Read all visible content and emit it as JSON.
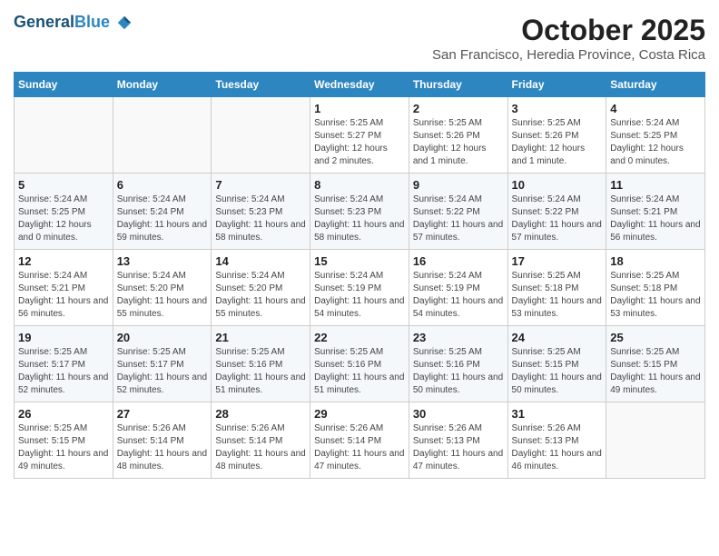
{
  "header": {
    "logo_line1": "General",
    "logo_line2": "Blue",
    "month_year": "October 2025",
    "location": "San Francisco, Heredia Province, Costa Rica"
  },
  "days_of_week": [
    "Sunday",
    "Monday",
    "Tuesday",
    "Wednesday",
    "Thursday",
    "Friday",
    "Saturday"
  ],
  "weeks": [
    [
      {
        "day": "",
        "sunrise": "",
        "sunset": "",
        "daylight": ""
      },
      {
        "day": "",
        "sunrise": "",
        "sunset": "",
        "daylight": ""
      },
      {
        "day": "",
        "sunrise": "",
        "sunset": "",
        "daylight": ""
      },
      {
        "day": "1",
        "sunrise": "Sunrise: 5:25 AM",
        "sunset": "Sunset: 5:27 PM",
        "daylight": "Daylight: 12 hours and 2 minutes."
      },
      {
        "day": "2",
        "sunrise": "Sunrise: 5:25 AM",
        "sunset": "Sunset: 5:26 PM",
        "daylight": "Daylight: 12 hours and 1 minute."
      },
      {
        "day": "3",
        "sunrise": "Sunrise: 5:25 AM",
        "sunset": "Sunset: 5:26 PM",
        "daylight": "Daylight: 12 hours and 1 minute."
      },
      {
        "day": "4",
        "sunrise": "Sunrise: 5:24 AM",
        "sunset": "Sunset: 5:25 PM",
        "daylight": "Daylight: 12 hours and 0 minutes."
      }
    ],
    [
      {
        "day": "5",
        "sunrise": "Sunrise: 5:24 AM",
        "sunset": "Sunset: 5:25 PM",
        "daylight": "Daylight: 12 hours and 0 minutes."
      },
      {
        "day": "6",
        "sunrise": "Sunrise: 5:24 AM",
        "sunset": "Sunset: 5:24 PM",
        "daylight": "Daylight: 11 hours and 59 minutes."
      },
      {
        "day": "7",
        "sunrise": "Sunrise: 5:24 AM",
        "sunset": "Sunset: 5:23 PM",
        "daylight": "Daylight: 11 hours and 58 minutes."
      },
      {
        "day": "8",
        "sunrise": "Sunrise: 5:24 AM",
        "sunset": "Sunset: 5:23 PM",
        "daylight": "Daylight: 11 hours and 58 minutes."
      },
      {
        "day": "9",
        "sunrise": "Sunrise: 5:24 AM",
        "sunset": "Sunset: 5:22 PM",
        "daylight": "Daylight: 11 hours and 57 minutes."
      },
      {
        "day": "10",
        "sunrise": "Sunrise: 5:24 AM",
        "sunset": "Sunset: 5:22 PM",
        "daylight": "Daylight: 11 hours and 57 minutes."
      },
      {
        "day": "11",
        "sunrise": "Sunrise: 5:24 AM",
        "sunset": "Sunset: 5:21 PM",
        "daylight": "Daylight: 11 hours and 56 minutes."
      }
    ],
    [
      {
        "day": "12",
        "sunrise": "Sunrise: 5:24 AM",
        "sunset": "Sunset: 5:21 PM",
        "daylight": "Daylight: 11 hours and 56 minutes."
      },
      {
        "day": "13",
        "sunrise": "Sunrise: 5:24 AM",
        "sunset": "Sunset: 5:20 PM",
        "daylight": "Daylight: 11 hours and 55 minutes."
      },
      {
        "day": "14",
        "sunrise": "Sunrise: 5:24 AM",
        "sunset": "Sunset: 5:20 PM",
        "daylight": "Daylight: 11 hours and 55 minutes."
      },
      {
        "day": "15",
        "sunrise": "Sunrise: 5:24 AM",
        "sunset": "Sunset: 5:19 PM",
        "daylight": "Daylight: 11 hours and 54 minutes."
      },
      {
        "day": "16",
        "sunrise": "Sunrise: 5:24 AM",
        "sunset": "Sunset: 5:19 PM",
        "daylight": "Daylight: 11 hours and 54 minutes."
      },
      {
        "day": "17",
        "sunrise": "Sunrise: 5:25 AM",
        "sunset": "Sunset: 5:18 PM",
        "daylight": "Daylight: 11 hours and 53 minutes."
      },
      {
        "day": "18",
        "sunrise": "Sunrise: 5:25 AM",
        "sunset": "Sunset: 5:18 PM",
        "daylight": "Daylight: 11 hours and 53 minutes."
      }
    ],
    [
      {
        "day": "19",
        "sunrise": "Sunrise: 5:25 AM",
        "sunset": "Sunset: 5:17 PM",
        "daylight": "Daylight: 11 hours and 52 minutes."
      },
      {
        "day": "20",
        "sunrise": "Sunrise: 5:25 AM",
        "sunset": "Sunset: 5:17 PM",
        "daylight": "Daylight: 11 hours and 52 minutes."
      },
      {
        "day": "21",
        "sunrise": "Sunrise: 5:25 AM",
        "sunset": "Sunset: 5:16 PM",
        "daylight": "Daylight: 11 hours and 51 minutes."
      },
      {
        "day": "22",
        "sunrise": "Sunrise: 5:25 AM",
        "sunset": "Sunset: 5:16 PM",
        "daylight": "Daylight: 11 hours and 51 minutes."
      },
      {
        "day": "23",
        "sunrise": "Sunrise: 5:25 AM",
        "sunset": "Sunset: 5:16 PM",
        "daylight": "Daylight: 11 hours and 50 minutes."
      },
      {
        "day": "24",
        "sunrise": "Sunrise: 5:25 AM",
        "sunset": "Sunset: 5:15 PM",
        "daylight": "Daylight: 11 hours and 50 minutes."
      },
      {
        "day": "25",
        "sunrise": "Sunrise: 5:25 AM",
        "sunset": "Sunset: 5:15 PM",
        "daylight": "Daylight: 11 hours and 49 minutes."
      }
    ],
    [
      {
        "day": "26",
        "sunrise": "Sunrise: 5:25 AM",
        "sunset": "Sunset: 5:15 PM",
        "daylight": "Daylight: 11 hours and 49 minutes."
      },
      {
        "day": "27",
        "sunrise": "Sunrise: 5:26 AM",
        "sunset": "Sunset: 5:14 PM",
        "daylight": "Daylight: 11 hours and 48 minutes."
      },
      {
        "day": "28",
        "sunrise": "Sunrise: 5:26 AM",
        "sunset": "Sunset: 5:14 PM",
        "daylight": "Daylight: 11 hours and 48 minutes."
      },
      {
        "day": "29",
        "sunrise": "Sunrise: 5:26 AM",
        "sunset": "Sunset: 5:14 PM",
        "daylight": "Daylight: 11 hours and 47 minutes."
      },
      {
        "day": "30",
        "sunrise": "Sunrise: 5:26 AM",
        "sunset": "Sunset: 5:13 PM",
        "daylight": "Daylight: 11 hours and 47 minutes."
      },
      {
        "day": "31",
        "sunrise": "Sunrise: 5:26 AM",
        "sunset": "Sunset: 5:13 PM",
        "daylight": "Daylight: 11 hours and 46 minutes."
      },
      {
        "day": "",
        "sunrise": "",
        "sunset": "",
        "daylight": ""
      }
    ]
  ]
}
